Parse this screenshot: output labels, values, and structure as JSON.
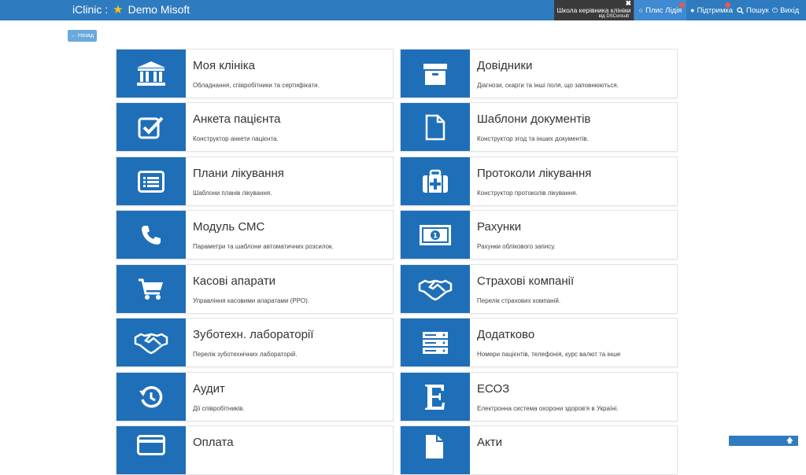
{
  "header": {
    "app_name": "iClinic :",
    "clinic_name": "Demo Misoft",
    "school_line1": "Школа керівника клініки",
    "school_line2": "від DSConsult",
    "user_name": "Плис Лідія",
    "support": "Підтримка",
    "search": "Пошук",
    "exit": "Вихід"
  },
  "back_label": "Назад",
  "cards": [
    {
      "title": "Моя клініка",
      "desc": "Обладнання, співробітники та сертифікати.",
      "icon": "bank-icon"
    },
    {
      "title": "Довідники",
      "desc": "Діагнози, скарги та інші поля, що заповнюються.",
      "icon": "archive-box-icon"
    },
    {
      "title": "Анкета пацієнта",
      "desc": "Конструктор анкети пацієнта.",
      "icon": "checkbox-icon"
    },
    {
      "title": "Шаблони документів",
      "desc": "Конструктор згод та інших документів.",
      "icon": "document-icon"
    },
    {
      "title": "Плани лікування",
      "desc": "Шаблони планів лікування.",
      "icon": "list-alt-icon"
    },
    {
      "title": "Протоколи лікування",
      "desc": "Конструктор протоколів лікування.",
      "icon": "medkit-icon"
    },
    {
      "title": "Модуль СМС",
      "desc": "Параметри та шаблони автоматичних розсилок.",
      "icon": "phone-icon"
    },
    {
      "title": "Рахунки",
      "desc": "Рахунки облікового запису.",
      "icon": "money-bill-icon"
    },
    {
      "title": "Касові апарати",
      "desc": "Управління касовими апаратами (PPO).",
      "icon": "cart-icon"
    },
    {
      "title": "Страхові компанії",
      "desc": "Перелік страхових компаній.",
      "icon": "handshake-icon"
    },
    {
      "title": "Зуботехн. лабораторії",
      "desc": "Перелік зуботехнічних лабораторій.",
      "icon": "handshake-icon"
    },
    {
      "title": "Додатково",
      "desc": "Номери пацієнтів, телефонія, курс валют та інше",
      "icon": "server-icon"
    },
    {
      "title": "Аудит",
      "desc": "Дії співробітників.",
      "icon": "history-icon"
    },
    {
      "title": "ЕСОЗ",
      "desc": "Електронна система охорони здоров'я в Україні.",
      "icon": "letter-e-icon"
    },
    {
      "title": "Оплата",
      "desc": "",
      "icon": "credit-card-icon"
    },
    {
      "title": "Акти",
      "desc": "",
      "icon": "file-signature-icon"
    }
  ]
}
